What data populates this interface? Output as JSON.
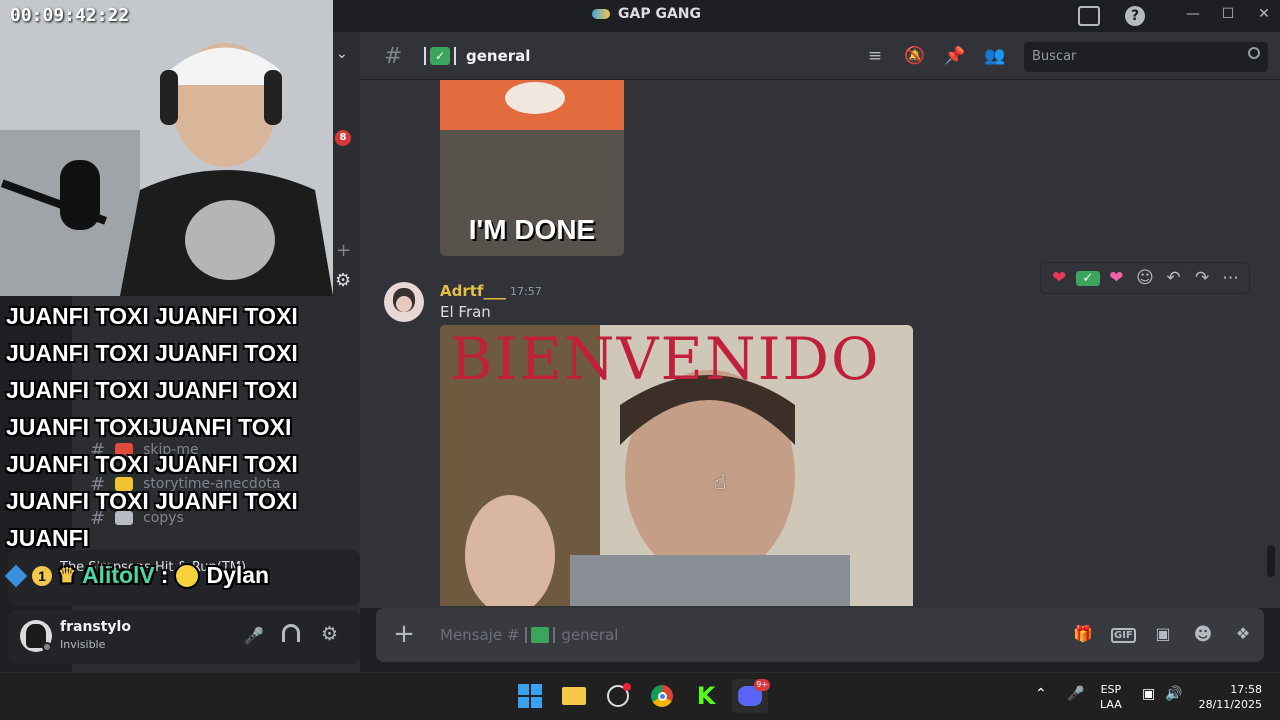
{
  "window": {
    "title": "GAP GANG"
  },
  "stream_overlay": {
    "timer": "00:09:42:22",
    "chat_lines": [
      "JUANFI TOXI JUANFI TOXI",
      "JUANFI TOXI JUANFI TOXI",
      "JUANFI TOXI JUANFI TOXI",
      "JUANFI TOXIJUANFI TOXI",
      "JUANFI TOXI JUANFI TOXI",
      "JUANFI TOXI JUANFI TOXI",
      "JUANFI"
    ],
    "chat_user": "AlitolV",
    "chat_sep": ":",
    "chat_msg": "Dylan",
    "badge_count": "1"
  },
  "sidebar": {
    "notification_badge": "8",
    "channels": [
      {
        "name": "skip-me",
        "color": "#e04a3a"
      },
      {
        "name": "storytime-anecdota",
        "color": "#f0c330"
      },
      {
        "name": "copys",
        "color": "#b8bcc4"
      }
    ],
    "activity": {
      "game": "The Simpsons Hit & Run(TM)"
    },
    "user": {
      "name": "franstylo",
      "status": "Invisible"
    }
  },
  "channel": {
    "name": "general",
    "search_placeholder": "Buscar"
  },
  "messages": {
    "gif1_caption": "I'M DONE",
    "author": "Adrtf___",
    "time": "17:57",
    "text": "El Fran",
    "gif2_caption": "BIENVENIDO"
  },
  "composer": {
    "placeholder_prefix": "Mensaje #",
    "channel": "general"
  },
  "taskbar": {
    "lang_top": "ESP",
    "lang_bottom": "LAA",
    "time": "17:58",
    "date": "28/11/2025",
    "discord_badge": "9+"
  },
  "colors": {
    "author": "#e2c046",
    "accent": "#5865f2",
    "badge": "#da373c"
  }
}
